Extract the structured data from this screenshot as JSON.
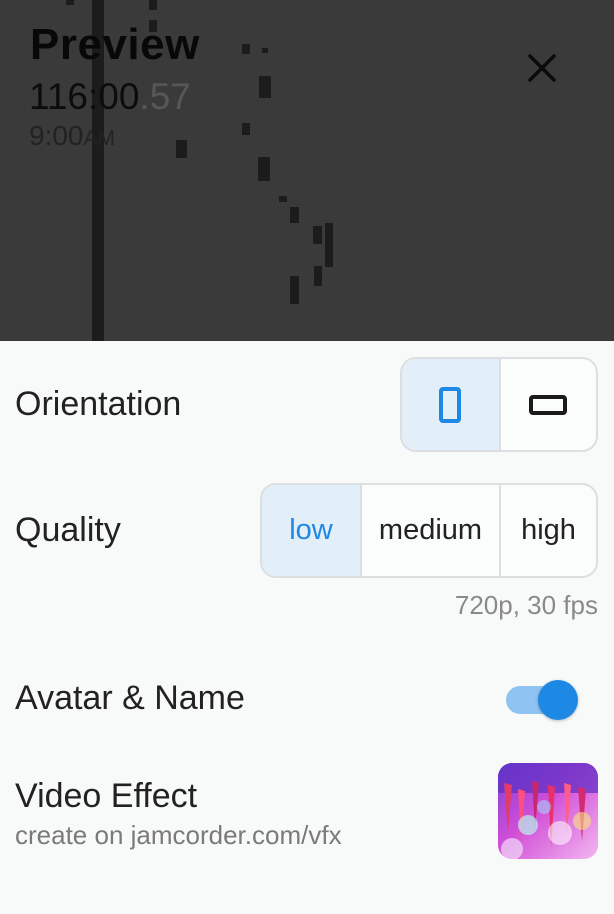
{
  "preview": {
    "title": "Preview",
    "timer_main": "116:00",
    "timer_fraction": ".57",
    "clock_time": "9:00",
    "clock_ampm": "AM"
  },
  "settings": {
    "orientation": {
      "label": "Orientation",
      "options": [
        {
          "name": "portrait",
          "icon": "portrait-phone-icon",
          "selected": true
        },
        {
          "name": "landscape",
          "icon": "landscape-phone-icon",
          "selected": false
        }
      ]
    },
    "quality": {
      "label": "Quality",
      "options": [
        "low",
        "medium",
        "high"
      ],
      "selected": "low",
      "note": "720p, 30 fps"
    },
    "avatar_name": {
      "label": "Avatar & Name",
      "enabled": true
    },
    "video_effect": {
      "label": "Video Effect",
      "sublabel": "create on jamcorder.com/vfx",
      "thumbnail_icon": "video-effect-thumbnail"
    }
  },
  "colors": {
    "accent": "#1e88e5",
    "accent_light": "#8ec3f2",
    "selected_bg": "#e2eef8",
    "preview_bg": "#3a3a3a",
    "panel_bg": "#f8fafa"
  }
}
